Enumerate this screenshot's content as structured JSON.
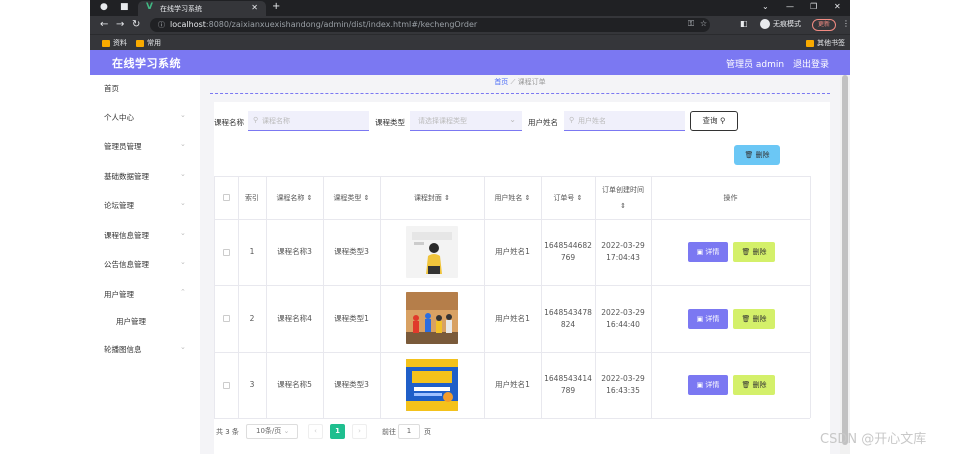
{
  "browser": {
    "tab_title": "在线学习系统",
    "url_host": "localhost",
    "url_rest": ":8080/zaixianxuexishandong/admin/dist/index.html#/kechengOrder",
    "incognito_label": "无痕模式",
    "update_label": "更新",
    "bookmarks": [
      "资料",
      "常用"
    ],
    "other_bookmarks": "其他书签"
  },
  "header": {
    "app_title": "在线学习系统",
    "user": "管理员 admin",
    "logout": "退出登录"
  },
  "sidebar": {
    "items": [
      {
        "label": "首页",
        "has_chevron": false
      },
      {
        "label": "个人中心",
        "has_chevron": true
      },
      {
        "label": "管理员管理",
        "has_chevron": true
      },
      {
        "label": "基础数据管理",
        "has_chevron": true
      },
      {
        "label": "论坛管理",
        "has_chevron": true
      },
      {
        "label": "课程信息管理",
        "has_chevron": true
      },
      {
        "label": "公告信息管理",
        "has_chevron": true
      },
      {
        "label": "用户管理",
        "has_chevron": true
      },
      {
        "label": "用户管理",
        "has_chevron": false,
        "sub": true
      },
      {
        "label": "轮播图信息",
        "has_chevron": true
      }
    ]
  },
  "breadcrumb": {
    "home": "首页",
    "current": "课程订单"
  },
  "filters": {
    "course_name_label": "课程名称",
    "course_name_placeholder": "课程名称",
    "course_type_label": "课程类型",
    "course_type_placeholder": "请选择课程类型",
    "user_name_label": "用户姓名",
    "user_name_placeholder": "用户姓名",
    "query_label": "查询"
  },
  "toolbar": {
    "delete_label": "删除"
  },
  "table": {
    "headers": {
      "index": "索引",
      "course_name": "课程名称",
      "course_type": "课程类型",
      "cover": "课程封面",
      "user_name": "用户姓名",
      "order_no": "订单号",
      "created": "订单创建时间",
      "actions": "操作"
    },
    "rows": [
      {
        "index": "1",
        "course_name": "课程名称3",
        "course_type": "课程类型3",
        "user_name": "用户姓名1",
        "order_no_1": "1648544682",
        "order_no_2": "769",
        "date": "2022-03-29",
        "time": "17:04:43"
      },
      {
        "index": "2",
        "course_name": "课程名称4",
        "course_type": "课程类型1",
        "user_name": "用户姓名1",
        "order_no_1": "1648543478",
        "order_no_2": "824",
        "date": "2022-03-29",
        "time": "16:44:40"
      },
      {
        "index": "3",
        "course_name": "课程名称5",
        "course_type": "课程类型3",
        "user_name": "用户姓名1",
        "order_no_1": "1648543414",
        "order_no_2": "789",
        "date": "2022-03-29",
        "time": "16:43:35"
      }
    ],
    "detail_label": "详情",
    "delete_label": "删除"
  },
  "pagination": {
    "total": "共 3 条",
    "page_size": "10条/页",
    "current_page": "1",
    "goto_label": "前往",
    "goto_value": "1",
    "page_unit": "页"
  },
  "watermark": "CSDN @开心文库",
  "colors": {
    "primary": "#7b78f2",
    "detail_button": "#7b78f2",
    "delete_button": "#d4f06a",
    "top_delete_button": "#6bc7f5",
    "active_page": "#1fbf8f"
  }
}
